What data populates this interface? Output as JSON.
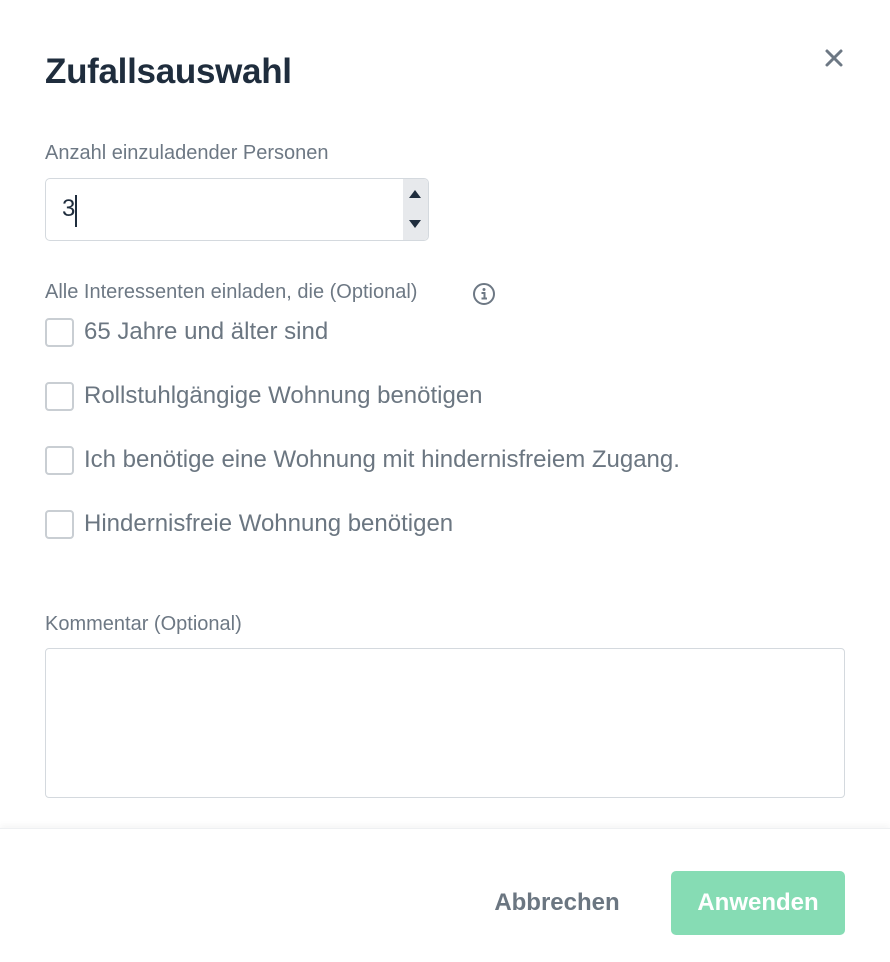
{
  "dialog": {
    "title": "Zufallsauswahl",
    "close_icon": "close-icon"
  },
  "count": {
    "label": "Anzahl einzuladender Personen",
    "value": "3"
  },
  "criteria": {
    "label": "Alle Interessenten einladen, die (Optional)",
    "info_icon": "info-icon",
    "options": [
      {
        "label": "65 Jahre und älter sind",
        "checked": false
      },
      {
        "label": "Rollstuhlgängige Wohnung benötigen",
        "checked": false
      },
      {
        "label": "Ich benötige eine Wohnung mit hindernisfreiem Zugang.",
        "checked": false
      },
      {
        "label": "Hindernisfreie Wohnung benötigen",
        "checked": false
      }
    ]
  },
  "comment": {
    "label": "Kommentar (Optional)",
    "value": ""
  },
  "footer": {
    "cancel_label": "Abbrechen",
    "apply_label": "Anwenden"
  },
  "colors": {
    "primary": "#86dcb4",
    "title": "#1f2d3d",
    "text": "#6b7681",
    "border": "#d4d9de"
  }
}
